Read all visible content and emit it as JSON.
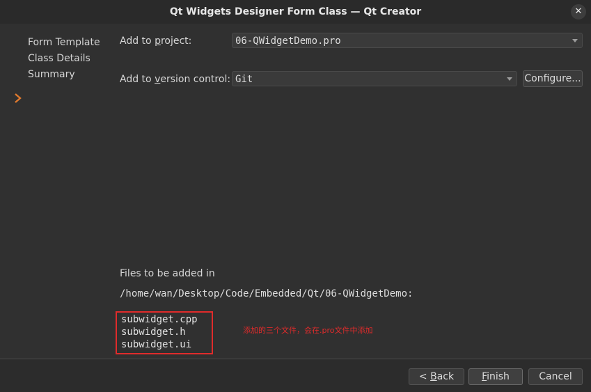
{
  "window": {
    "title": "Qt Widgets Designer Form Class — Qt Creator",
    "close_glyph": "✕"
  },
  "nav": {
    "items": [
      {
        "label": "Form Template"
      },
      {
        "label": "Class Details"
      },
      {
        "label": "Summary"
      }
    ],
    "current_index": 2,
    "current_icon": "chevron-right-icon",
    "accent_color": "#e07a2e"
  },
  "form": {
    "project_label_pre": "Add to ",
    "project_label_mnemonic": "p",
    "project_label_post": "roject:",
    "project_value": "06-QWidgetDemo.pro",
    "vcs_label_pre": "Add to ",
    "vcs_label_mnemonic": "v",
    "vcs_label_post": "ersion control:",
    "vcs_value": "Git",
    "configure_label": "Configure..."
  },
  "summary": {
    "files_heading": "Files to be added in",
    "path": "/home/wan/Desktop/Code/Embedded/Qt/06-QWidgetDemo:",
    "files": [
      "subwidget.cpp",
      "subwidget.h",
      "subwidget.ui"
    ],
    "annotation": "添加的三个文件，会在.pro文件中添加",
    "annotation_color": "#e02b2b"
  },
  "footer": {
    "back_prefix": "< ",
    "back_mnemonic": "B",
    "back_rest": "ack",
    "finish_mnemonic": "F",
    "finish_rest": "inish",
    "cancel_label": "Cancel"
  }
}
